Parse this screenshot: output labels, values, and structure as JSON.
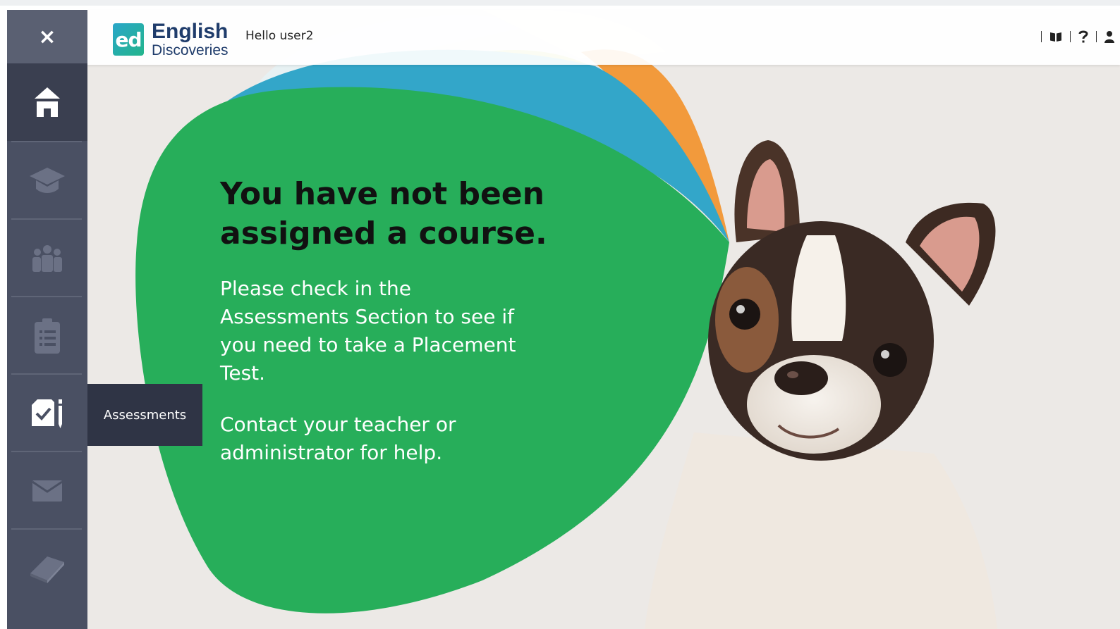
{
  "app": {
    "brand_mark": "ed",
    "brand_line1": "English",
    "brand_line2": "Discoveries",
    "greeting": "Hello user2"
  },
  "sidebar": {
    "close_label": "×",
    "items": [
      {
        "name": "home",
        "icon": "home-icon",
        "active": true
      },
      {
        "name": "courses",
        "icon": "graduation-cap-icon",
        "active": false
      },
      {
        "name": "community",
        "icon": "group-icon",
        "active": false
      },
      {
        "name": "tasks",
        "icon": "clipboard-icon",
        "active": false
      },
      {
        "name": "assessments",
        "icon": "assessment-icon",
        "active": false
      },
      {
        "name": "messages",
        "icon": "envelope-icon",
        "active": false
      },
      {
        "name": "library",
        "icon": "book-icon",
        "active": false
      }
    ],
    "tooltip": "Assessments"
  },
  "header_tools": [
    {
      "name": "dictionary",
      "icon": "open-book-icon"
    },
    {
      "name": "help",
      "icon": "question-icon"
    },
    {
      "name": "profile",
      "icon": "user-icon"
    }
  ],
  "message": {
    "headline": "You have not been assigned a course.",
    "paragraph1": "Please check in the Assessments Section to see if you need to take a Placement Test.",
    "paragraph2": "Contact your teacher or administrator for help."
  },
  "colors": {
    "sidebar": "#4a5063",
    "sidebar_active": "#3a3f50",
    "green": "#27ae5a",
    "blue": "#33a6c9",
    "lime": "#bed15a",
    "orange": "#f29a3c",
    "tooltip": "#2f3445"
  }
}
